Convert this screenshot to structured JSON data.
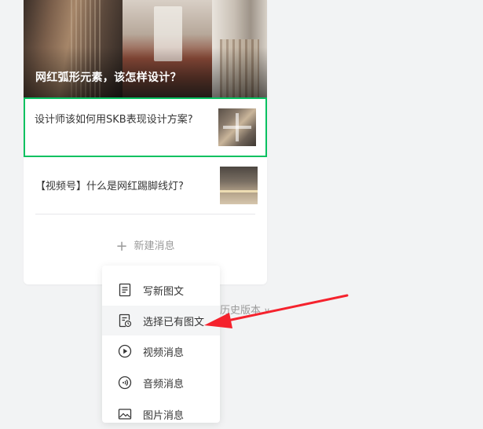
{
  "cover": {
    "title": "网红弧形元素，该怎样设计？"
  },
  "articles": [
    {
      "title": "设计师该如何用SKB表现设计方案?"
    },
    {
      "title": "【视频号】什么是网红踢脚线灯?"
    }
  ],
  "new_message": {
    "label": "新建消息"
  },
  "history": {
    "label": "历史版本"
  },
  "menu": {
    "items": [
      {
        "label": "写新图文",
        "icon": "document-icon"
      },
      {
        "label": "选择已有图文",
        "icon": "document-clock-icon"
      },
      {
        "label": "视频消息",
        "icon": "play-circle-icon"
      },
      {
        "label": "音频消息",
        "icon": "audio-circle-icon"
      },
      {
        "label": "图片消息",
        "icon": "image-icon"
      }
    ]
  },
  "colors": {
    "accent": "#07c160",
    "annotation_arrow": "#f5222d"
  }
}
